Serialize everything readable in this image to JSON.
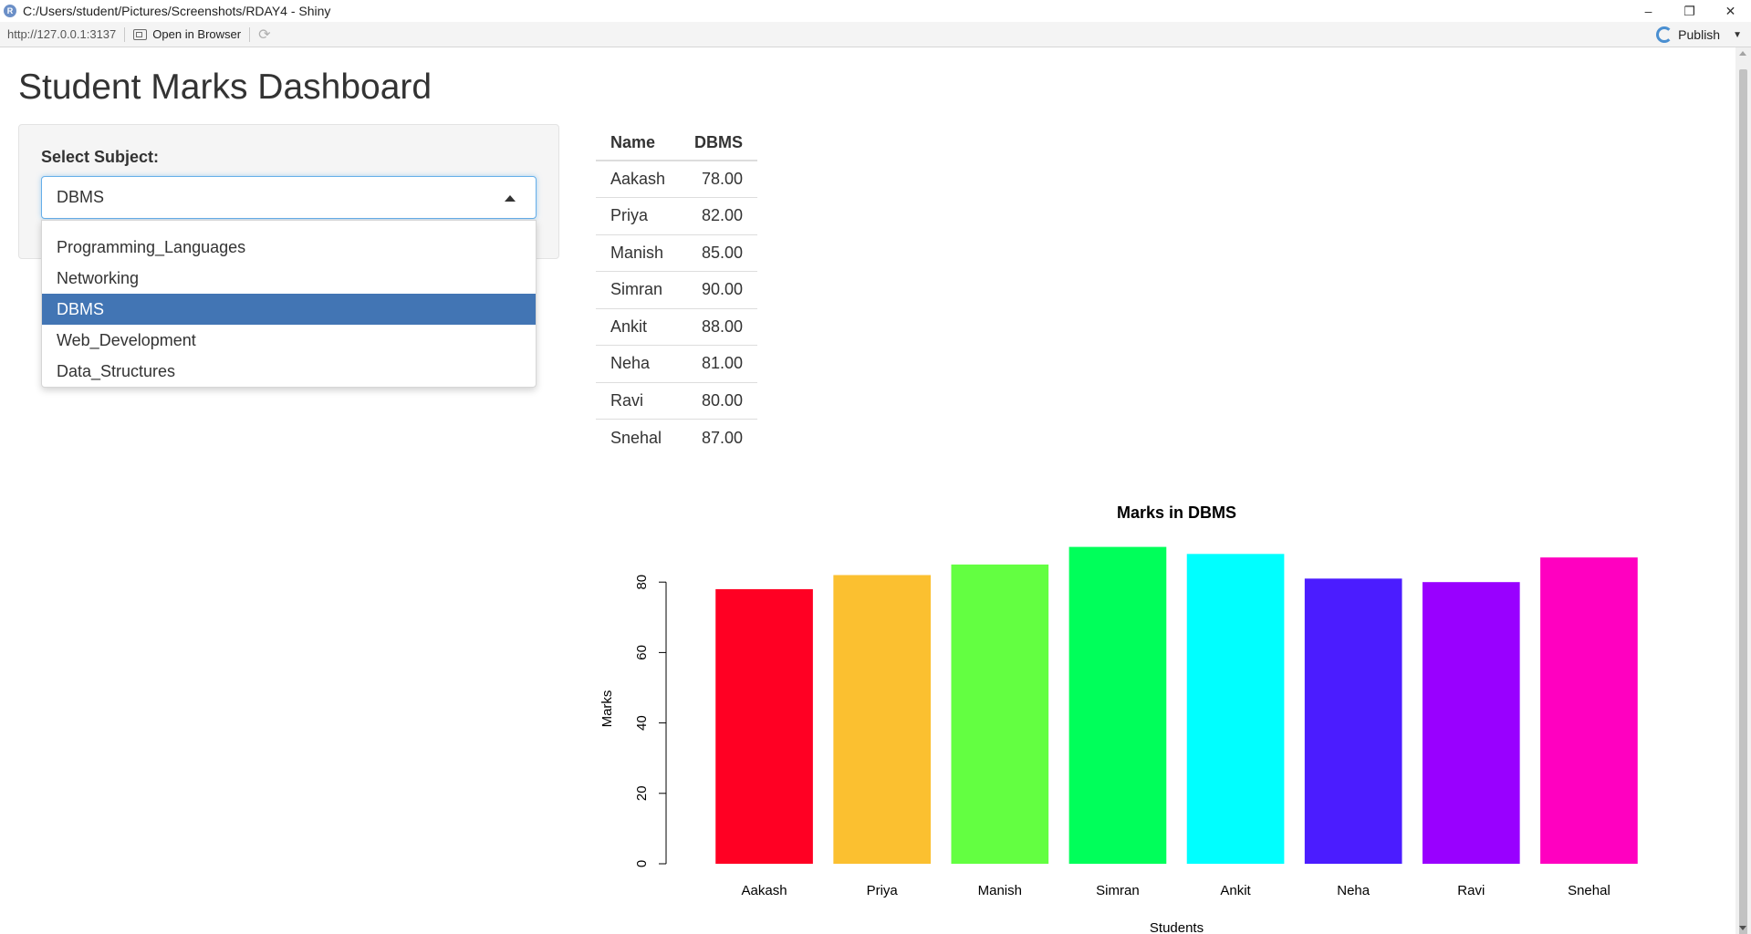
{
  "window": {
    "title": "C:/Users/student/Pictures/Screenshots/RDAY4 - Shiny",
    "controls": {
      "minimize": "–",
      "restore": "❐",
      "close": "✕"
    }
  },
  "toolbar": {
    "url": "http://127.0.0.1:3137",
    "open_in_browser": "Open in Browser",
    "publish": "Publish"
  },
  "page": {
    "title": "Student Marks Dashboard"
  },
  "sidebar": {
    "select_label": "Select Subject:",
    "selected_value": "DBMS",
    "options": [
      {
        "label": "Programming_Languages",
        "selected": false
      },
      {
        "label": "Networking",
        "selected": false
      },
      {
        "label": "DBMS",
        "selected": true
      },
      {
        "label": "Web_Development",
        "selected": false
      },
      {
        "label": "Data_Structures",
        "selected": false
      }
    ]
  },
  "table": {
    "headers": [
      "Name",
      "DBMS"
    ],
    "rows": [
      [
        "Aakash",
        "78.00"
      ],
      [
        "Priya",
        "82.00"
      ],
      [
        "Manish",
        "85.00"
      ],
      [
        "Simran",
        "90.00"
      ],
      [
        "Ankit",
        "88.00"
      ],
      [
        "Neha",
        "81.00"
      ],
      [
        "Ravi",
        "80.00"
      ],
      [
        "Snehal",
        "87.00"
      ]
    ]
  },
  "chart_data": {
    "type": "bar",
    "title": "Marks in DBMS",
    "xlabel": "Students",
    "ylabel": "Marks",
    "categories": [
      "Aakash",
      "Priya",
      "Manish",
      "Simran",
      "Ankit",
      "Neha",
      "Ravi",
      "Snehal"
    ],
    "values": [
      78,
      82,
      85,
      90,
      88,
      81,
      80,
      87
    ],
    "colors": [
      "#ff0023",
      "#fbc030",
      "#63ff41",
      "#00ff5a",
      "#00ffff",
      "#4b1cff",
      "#9900ff",
      "#ff00c0"
    ],
    "yticks": [
      0,
      20,
      40,
      60,
      80
    ],
    "ylim": [
      0,
      90
    ],
    "grid": false,
    "legend": "none"
  },
  "colors": {
    "accent": "#4275b4",
    "focus_border": "#66afe9"
  }
}
